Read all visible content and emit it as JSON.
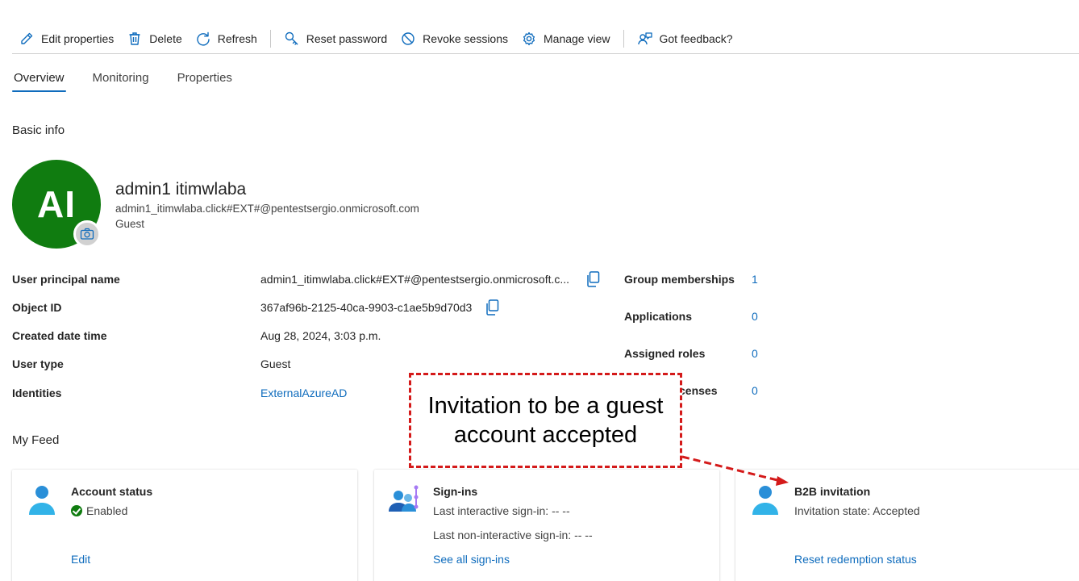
{
  "toolbar": {
    "edit_properties": "Edit properties",
    "delete": "Delete",
    "refresh": "Refresh",
    "reset_password": "Reset password",
    "revoke_sessions": "Revoke sessions",
    "manage_view": "Manage view",
    "got_feedback": "Got feedback?"
  },
  "tabs": [
    "Overview",
    "Monitoring",
    "Properties"
  ],
  "active_tab": "Overview",
  "basic_info": {
    "title": "Basic info",
    "initials": "AI",
    "avatar_color": "#107c10",
    "display_name": "admin1 itimwlaba",
    "upn": "admin1_itimwlaba.click#EXT#@pentestsergio.onmicrosoft.com",
    "user_type": "Guest"
  },
  "properties": {
    "upn_label": "User principal name",
    "upn_value": "admin1_itimwlaba.click#EXT#@pentestsergio.onmicrosoft.c...",
    "object_id_label": "Object ID",
    "object_id_value": "367af96b-2125-40ca-9903-c1ae5b9d70d3",
    "created_label": "Created date time",
    "created_value": "Aug 28, 2024, 3:03 p.m.",
    "user_type_label": "User type",
    "user_type_value": "Guest",
    "identities_label": "Identities",
    "identities_value": "ExternalAzureAD"
  },
  "stats": {
    "group_memberships_label": "Group memberships",
    "group_memberships_value": "1",
    "applications_label": "Applications",
    "applications_value": "0",
    "assigned_roles_label": "Assigned roles",
    "assigned_roles_value": "0",
    "licenses_label": "censes",
    "licenses_value": "0"
  },
  "feed": {
    "title": "My Feed",
    "account_status": {
      "title": "Account status",
      "status": "Enabled",
      "link": "Edit"
    },
    "sign_ins": {
      "title": "Sign-ins",
      "last_interactive": "Last interactive sign-in: -- --",
      "last_non_interactive": "Last non-interactive sign-in: -- --",
      "link": "See all sign-ins"
    },
    "b2b": {
      "title": "B2B invitation",
      "state": "Invitation state: Accepted",
      "link": "Reset redemption status"
    }
  },
  "annotation": {
    "text": "Invitation to be a guest account accepted",
    "color": "#d41a1a"
  },
  "colors": {
    "accent": "#0f6cbd",
    "enabled": "#107c10"
  }
}
